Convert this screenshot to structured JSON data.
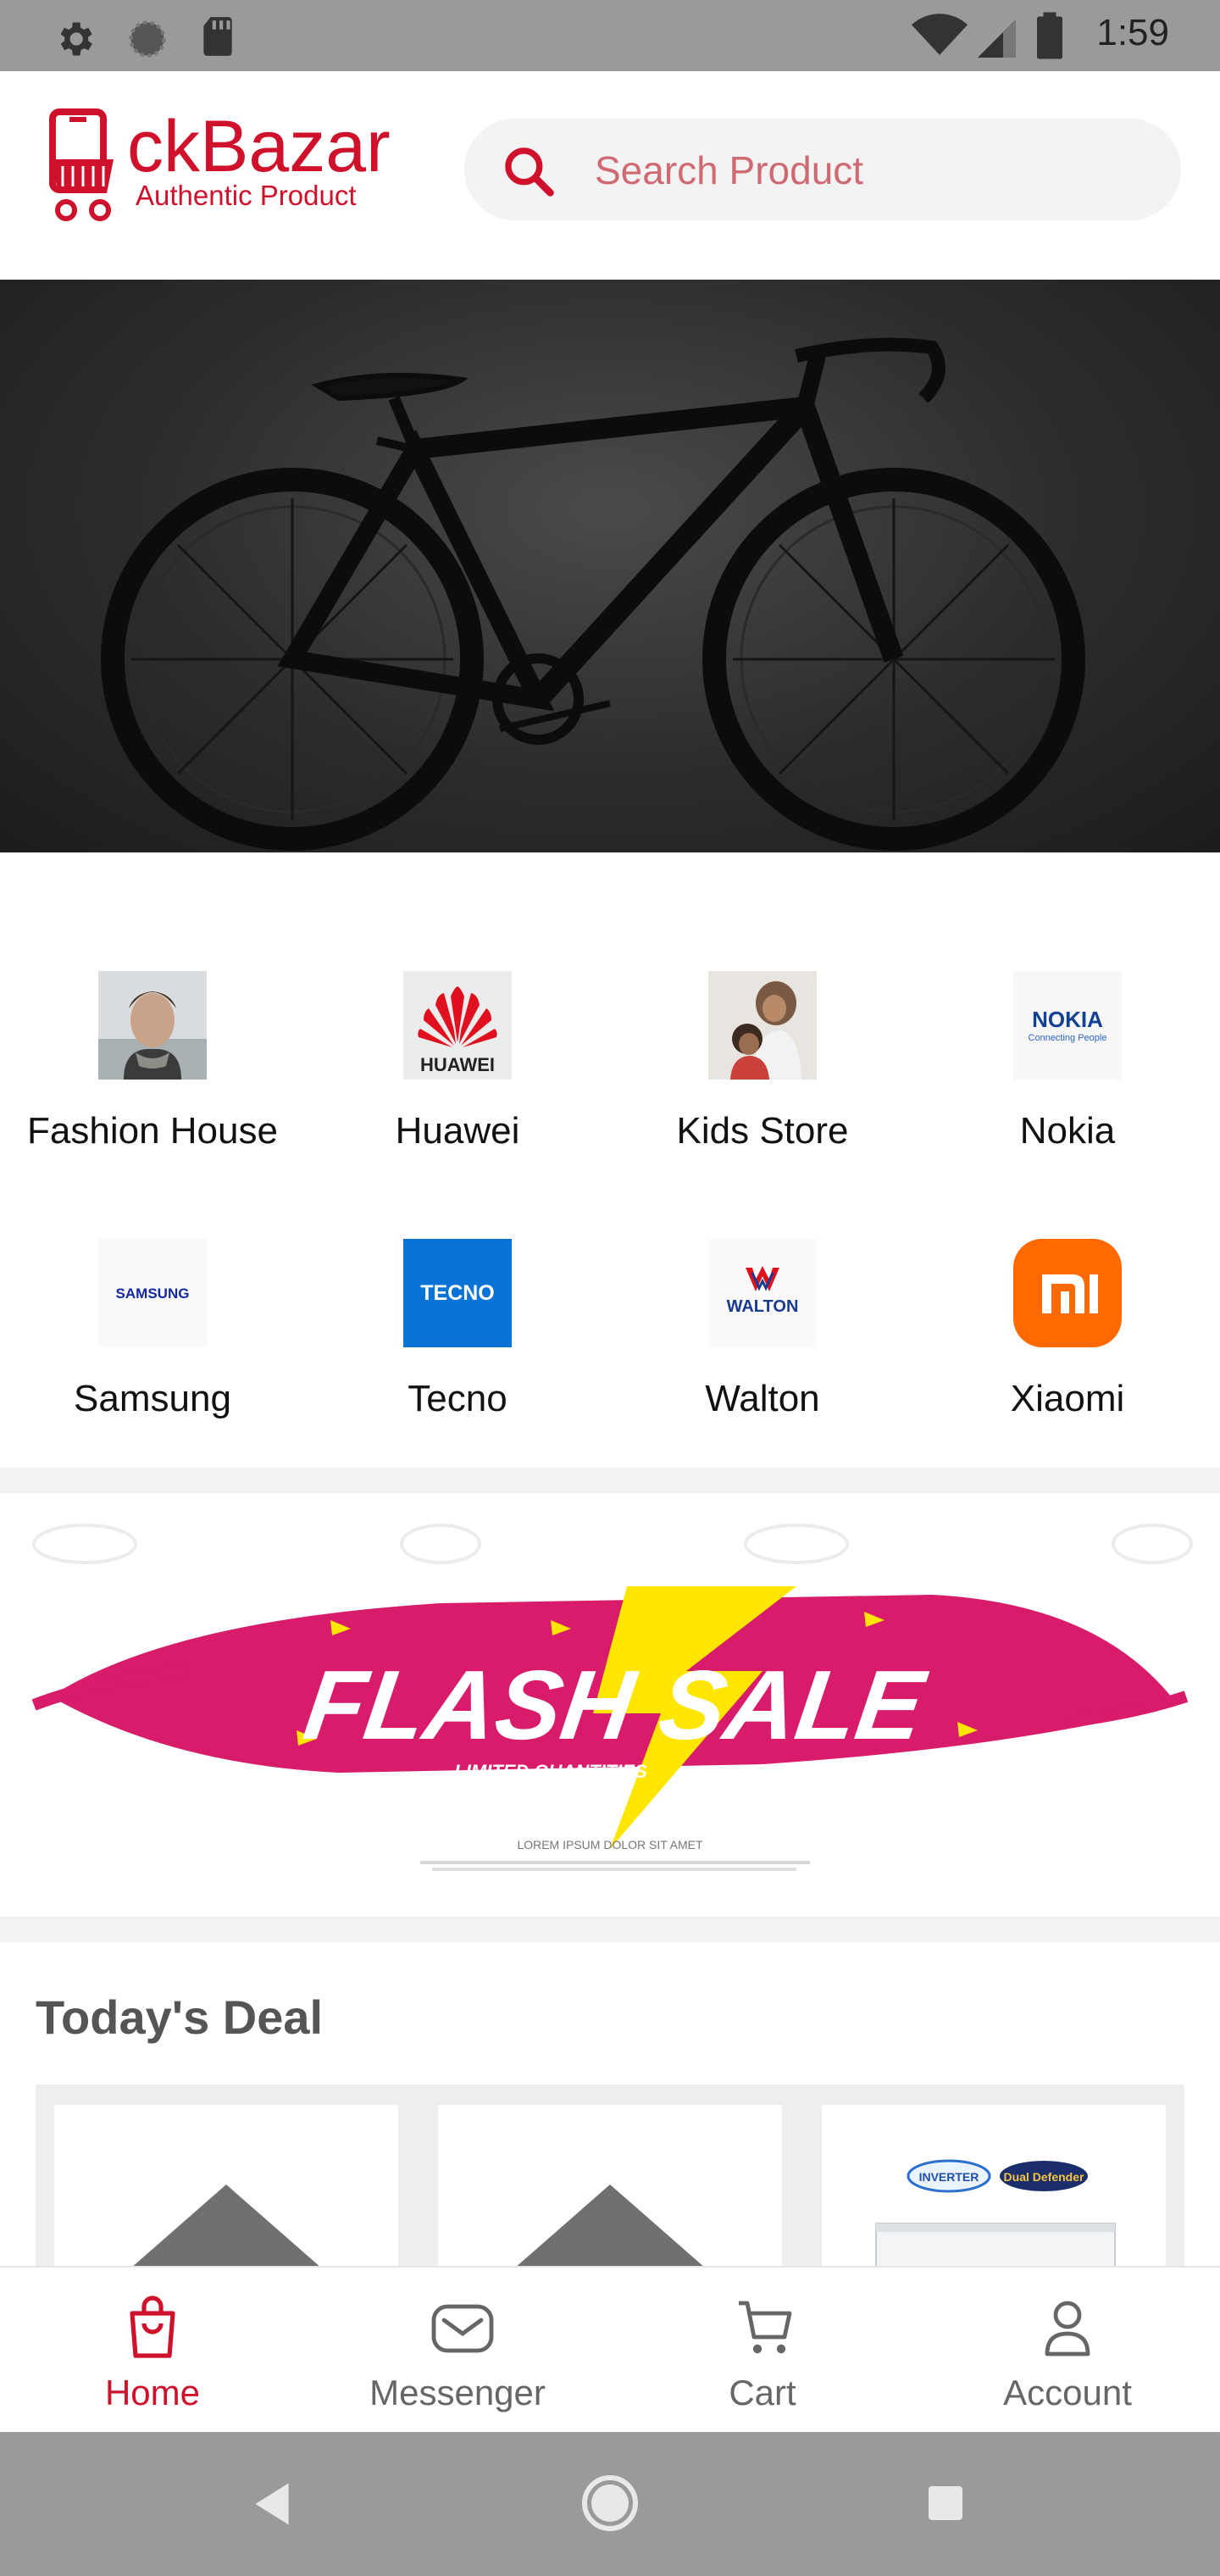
{
  "status_bar": {
    "time": "1:59"
  },
  "header": {
    "logo_text": "ckBazar",
    "logo_tagline": "Authentic Product",
    "search_placeholder": "Search Product"
  },
  "categories": [
    {
      "label": "Fashion House"
    },
    {
      "label": "Huawei"
    },
    {
      "label": "Kids Store"
    },
    {
      "label": "Nokia"
    },
    {
      "label": "Samsung"
    },
    {
      "label": "Tecno"
    },
    {
      "label": "Walton"
    },
    {
      "label": "Xiaomi"
    }
  ],
  "brand_logo_text": {
    "huawei": "HUAWEI",
    "nokia": "NOKIA",
    "nokia_tagline": "Connecting People",
    "samsung": "SAMSUNG",
    "tecno": "TECNO",
    "walton": "WALTON"
  },
  "flash_sale": {
    "title": "FLASH SALE",
    "subtitle": "LIMITED QUANTITIES",
    "caption": "LOREM IPSUM DOLOR SIT AMET"
  },
  "deals": {
    "title": "Today's Deal",
    "card3_badges": [
      "INVERTER",
      "Dual Defender"
    ]
  },
  "bottom_nav": [
    {
      "label": "Home",
      "icon": "shopping-bag-icon",
      "active": true
    },
    {
      "label": "Messenger",
      "icon": "envelope-icon",
      "active": false
    },
    {
      "label": "Cart",
      "icon": "cart-icon",
      "active": false
    },
    {
      "label": "Account",
      "icon": "user-icon",
      "active": false
    }
  ],
  "colors": {
    "brand_red": "#d0112b",
    "status_bar": "#9a9a9a",
    "search_bg": "#f3f3f3",
    "tecno_blue": "#0a74d6",
    "xiaomi_orange": "#ff6900",
    "flash_pink": "#d81b6a",
    "flash_yellow": "#ffe600"
  }
}
